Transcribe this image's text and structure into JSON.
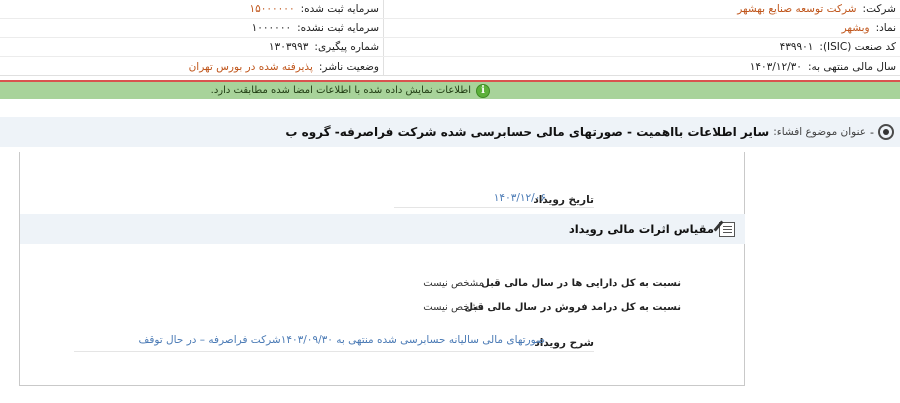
{
  "header": {
    "rows": [
      {
        "right_label": "شرکت:",
        "right_value": "شرکت توسعه صنایع بهشهر",
        "left_label": "سرمایه ثبت شده:",
        "left_value": "۱۵۰۰۰۰۰۰"
      },
      {
        "right_label": "نماد:",
        "right_value": "وبشهر",
        "left_label": "سرمایه ثبت نشده:",
        "left_value": "۱۰۰۰۰۰۰"
      },
      {
        "right_label": "کد صنعت (ISIC):",
        "right_value": "۴۳۹۹۰۱",
        "left_label": "شماره پیگیری:",
        "left_value": "۱۳۰۳۹۹۳"
      },
      {
        "right_label": "سال مالی منتهی به:",
        "right_value": "۱۴۰۳/۱۲/۳۰",
        "left_label": "وضعیت ناشر:",
        "left_value": "پذیرفته شده در بورس تهران"
      }
    ]
  },
  "alert": {
    "text": "اطلاعات نمایش داده شده با اطلاعات امضا شده مطابقت دارد.",
    "icon": "info-icon"
  },
  "subject": {
    "label": "عنوان موضوع افشاء:",
    "title": "سایر اطلاعات بااهمیت - صورتهای مالی حسابرسی شده شرکت فراصرفه- گروه ب",
    "icon": "target-icon"
  },
  "event": {
    "date_label": "تاریخ رویداد",
    "date_value": "۱۴۰۳/۱۲/۰۶"
  },
  "section": {
    "title": "مقیاس اثرات مالی رویداد",
    "icon": "edit-note-icon"
  },
  "ratios": [
    {
      "label": "نسبت به کل دارایی ها در سال مالی قبل",
      "value": "مشخص نیست"
    },
    {
      "label": "نسبت به کل درامد فروش در سال مالی قبل",
      "value": "مشخص نیست"
    }
  ],
  "description": {
    "label": "شرح رویداد",
    "value": "صورتهای مالی سالیانه حسابرسی شده منتهی به ۱۴۰۳/۰۹/۳۰شرکت فراصرفه – در حال توقف"
  }
}
